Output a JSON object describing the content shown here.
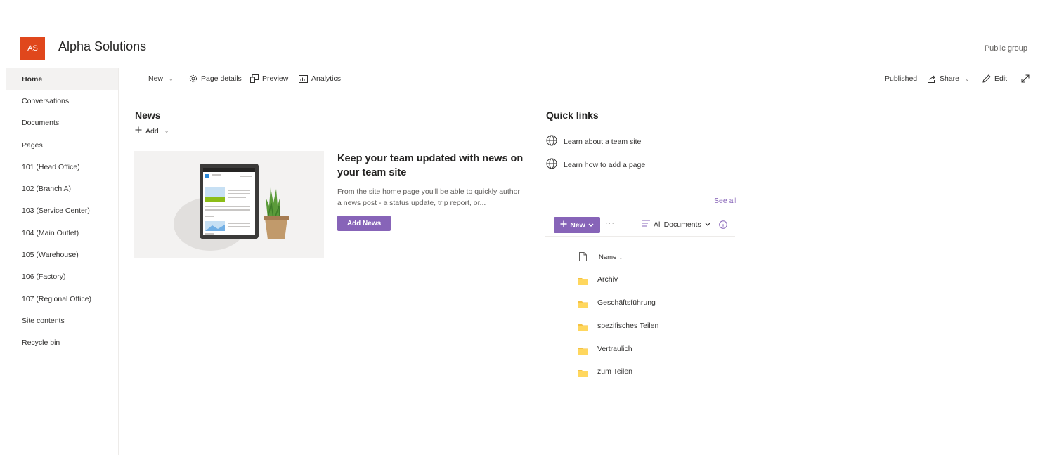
{
  "header": {
    "logo_text": "AS",
    "site_title": "Alpha Solutions",
    "group_type": "Public group",
    "logo_color": "#e0471c"
  },
  "nav": {
    "items": [
      {
        "label": "Home",
        "active": true
      },
      {
        "label": "Conversations"
      },
      {
        "label": "Documents"
      },
      {
        "label": "Pages"
      },
      {
        "label": "101 (Head Office)"
      },
      {
        "label": "102 (Branch A)"
      },
      {
        "label": "103 (Service Center)"
      },
      {
        "label": "104 (Main Outlet)"
      },
      {
        "label": "105 (Warehouse)"
      },
      {
        "label": "106 (Factory)"
      },
      {
        "label": "107 (Regional Office)"
      },
      {
        "label": "Site contents"
      },
      {
        "label": "Recycle bin"
      }
    ]
  },
  "commandbar": {
    "new_label": "New",
    "page_details_label": "Page details",
    "preview_label": "Preview",
    "analytics_label": "Analytics",
    "status": "Published",
    "share_label": "Share",
    "edit_label": "Edit"
  },
  "news": {
    "title": "News",
    "add_label": "Add",
    "heading": "Keep your team updated with news on your team site",
    "description": "From the site home page you'll be able to quickly author a news post - a status update, trip report, or...",
    "button_label": "Add News"
  },
  "quicklinks": {
    "title": "Quick links",
    "items": [
      {
        "label": "Learn about a team site",
        "icon": "globe-icon"
      },
      {
        "label": "Learn how to add a page",
        "icon": "globe-icon"
      }
    ]
  },
  "library": {
    "see_all": "See all",
    "new_label": "New",
    "more": "···",
    "view_label": "All Documents",
    "column_name": "Name",
    "rows": [
      {
        "name": "Archiv",
        "icon": "folder-icon"
      },
      {
        "name": "Geschäftsführung",
        "icon": "folder-icon"
      },
      {
        "name": "spezifisches Teilen",
        "icon": "folder-icon"
      },
      {
        "name": "Vertraulich",
        "icon": "folder-icon"
      },
      {
        "name": "zum Teilen",
        "icon": "folder-icon"
      }
    ]
  },
  "colors": {
    "accent": "#8764b8",
    "folder": "#f5c243",
    "nav_active_bg": "#f3f2f1"
  }
}
